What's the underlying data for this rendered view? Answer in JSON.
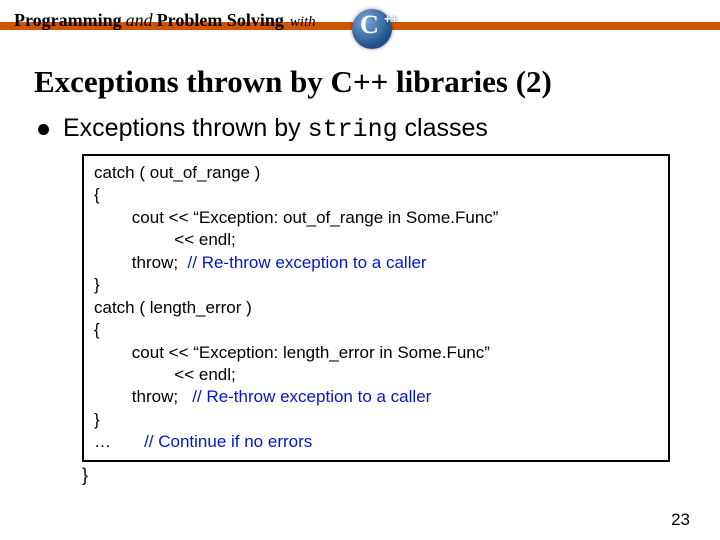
{
  "banner": {
    "word1": "Programming",
    "and": "and",
    "word2": "Problem Solving",
    "with": "with",
    "badge_letter": "C",
    "badge_plus": "++"
  },
  "title": "Exceptions thrown by C++ libraries (2)",
  "bullet": {
    "before": "Exceptions thrown by ",
    "code": "string",
    "after": " classes"
  },
  "code": {
    "l1": "catch ( out_of_range )",
    "l2": "{",
    "l3": "        cout << “Exception: out_of_range in Some.Func”",
    "l4": "                 << endl;",
    "l5a": "        throw;  ",
    "l5b": "// Re-throw exception to a caller",
    "l6": "}",
    "l7": "catch ( length_error )",
    "l8": "{",
    "l9": "        cout << “Exception: length_error in Some.Func”",
    "l10": "                 << endl;",
    "l11a": "        throw;   ",
    "l11b": "// Re-throw exception to a caller",
    "l12": "}",
    "l13a": "…       ",
    "l13b": "// Continue if no errors",
    "outer_close": "}"
  },
  "page_number": "23"
}
